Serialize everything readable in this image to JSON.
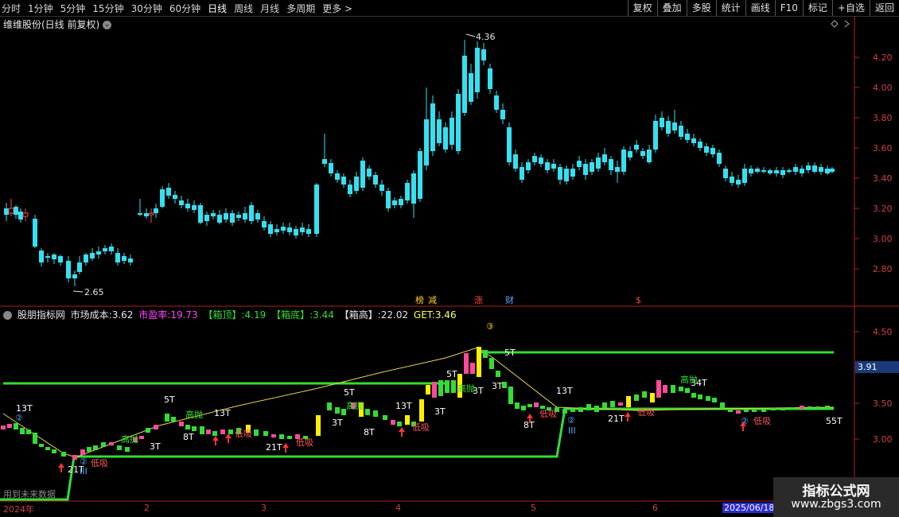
{
  "toolbar": {
    "periods": [
      "分时",
      "1分钟",
      "5分钟",
      "15分钟",
      "30分钟",
      "60分钟",
      "日线",
      "周线",
      "月线",
      "多周期",
      "更多 >"
    ],
    "active_period": "日线",
    "actions": [
      "复权",
      "叠加",
      "多股",
      "统计",
      "画线",
      "F10",
      "标记",
      "+自选",
      "返回"
    ]
  },
  "main_chart": {
    "title": "维维股份(日线 前复权)",
    "y_ticks": [
      "4.20",
      "4.00",
      "3.80",
      "3.60",
      "3.40",
      "3.20",
      "3.00",
      "2.80"
    ],
    "high_label": "4.36",
    "low_label": "2.65",
    "event_markers": [
      "榜",
      "减",
      "涨",
      "财",
      "$"
    ]
  },
  "indicator": {
    "name": "股朋指标网",
    "cost_label": "市场成本:",
    "cost_value": "3.62",
    "pe_label": "市盈率:",
    "pe_value": "19.73",
    "top_label": "【箱顶】:",
    "top_value": "4.19",
    "bottom_label": "【箱底】:",
    "bottom_value": "3.44",
    "height_label": "【箱高】:",
    "height_value": "22.02",
    "get_label": "GET:",
    "get_value": "3.46",
    "y_ticks": [
      "4.50",
      "4.00",
      "3.50",
      "3.00"
    ],
    "current_value": "3.91",
    "bottom_note": "用到未来数据",
    "labels": {
      "t13a": "13T",
      "t21a": "21T",
      "t3a": "3T",
      "t5a": "5T",
      "t8a": "8T",
      "t13b": "13T",
      "t21b": "21T",
      "t5b": "5T",
      "t3b": "3T",
      "t8b": "8T",
      "t13c": "13T",
      "t3c": "3T",
      "t5c": "5T",
      "t3d": "3T",
      "t5d": "5T",
      "t3e": "3T",
      "t8c": "8T",
      "t13d": "13T",
      "t21c": "21T",
      "t34": "34T",
      "t55": "55T",
      "gaopao": "高抛",
      "dixi": "低吸",
      "circle3": "③",
      "circle2": "②",
      "roman3": "III",
      "roman2": "II"
    }
  },
  "x_dates": [
    "2024年",
    "2",
    "3",
    "4",
    "5",
    "6",
    "2025/06/18"
  ],
  "watermark": {
    "line1": "指标公式网",
    "line2": "www.zbgs3.com"
  }
}
